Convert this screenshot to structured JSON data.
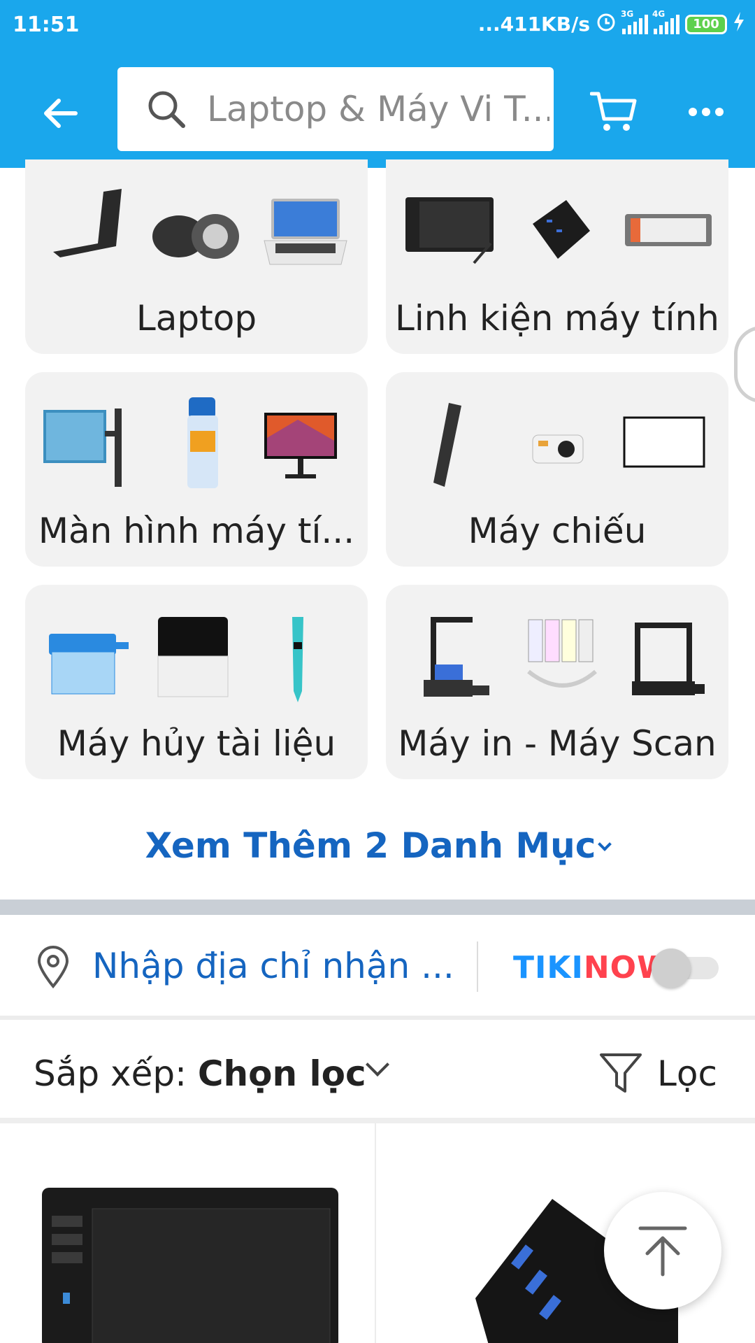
{
  "status_bar": {
    "time": "11:51",
    "network_speed": "...411KB/s",
    "sim1_type": "3G",
    "sim2_type": "4G",
    "battery": "100"
  },
  "header": {
    "search_text": "Laptop & Máy Vi T...",
    "accent_color": "#1aa7ec"
  },
  "categories": [
    {
      "label": "Laptop"
    },
    {
      "label": "Linh kiện máy tính"
    },
    {
      "label": "Màn hình máy tí..."
    },
    {
      "label": "Máy chiếu"
    },
    {
      "label": "Máy hủy tài liệu"
    },
    {
      "label": "Máy in - Máy Scan"
    }
  ],
  "see_more": "Xem Thêm 2 Danh Mục",
  "address": {
    "placeholder": "Nhập địa chỉ nhận ...",
    "tikinow_part1": "TIKI",
    "tikinow_part2": "NOW",
    "tikinow_colors": {
      "tiki": "#1a94ff",
      "now": "#ff424e"
    },
    "toggle_on": false
  },
  "sort": {
    "label": "Sắp xếp: ",
    "value": "Chọn lọc",
    "filter_label": "Lọc"
  },
  "icons": [
    "back-arrow-icon",
    "search-icon",
    "cart-icon",
    "more-icon",
    "location-pin-icon",
    "filter-icon",
    "scroll-to-top-icon",
    "chevron-down-icon"
  ]
}
